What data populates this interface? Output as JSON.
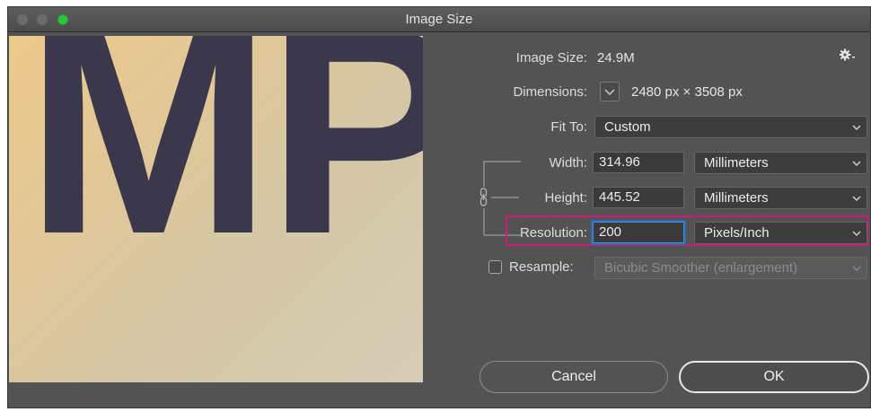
{
  "window": {
    "title": "Image Size"
  },
  "preview": {
    "letters": "MP"
  },
  "image_size": {
    "label": "Image Size:",
    "value": "24.9M"
  },
  "dimensions": {
    "label": "Dimensions:",
    "value": "2480 px  ×  3508 px"
  },
  "fit_to": {
    "label": "Fit To:",
    "value": "Custom"
  },
  "width": {
    "label": "Width:",
    "value": "314.96",
    "unit": "Millimeters"
  },
  "height": {
    "label": "Height:",
    "value": "445.52",
    "unit": "Millimeters"
  },
  "resolution": {
    "label": "Resolution:",
    "value": "200",
    "unit": "Pixels/Inch"
  },
  "resample": {
    "label": "Resample:",
    "checked": false,
    "value": "Bicubic Smoother (enlargement)"
  },
  "buttons": {
    "cancel": "Cancel",
    "ok": "OK"
  },
  "colors": {
    "highlight": "#d4187b",
    "zoom_button": "#2dc53f",
    "background": "#535353"
  },
  "icons": {
    "settings": "gear-icon",
    "link": "chain-link-icon"
  }
}
